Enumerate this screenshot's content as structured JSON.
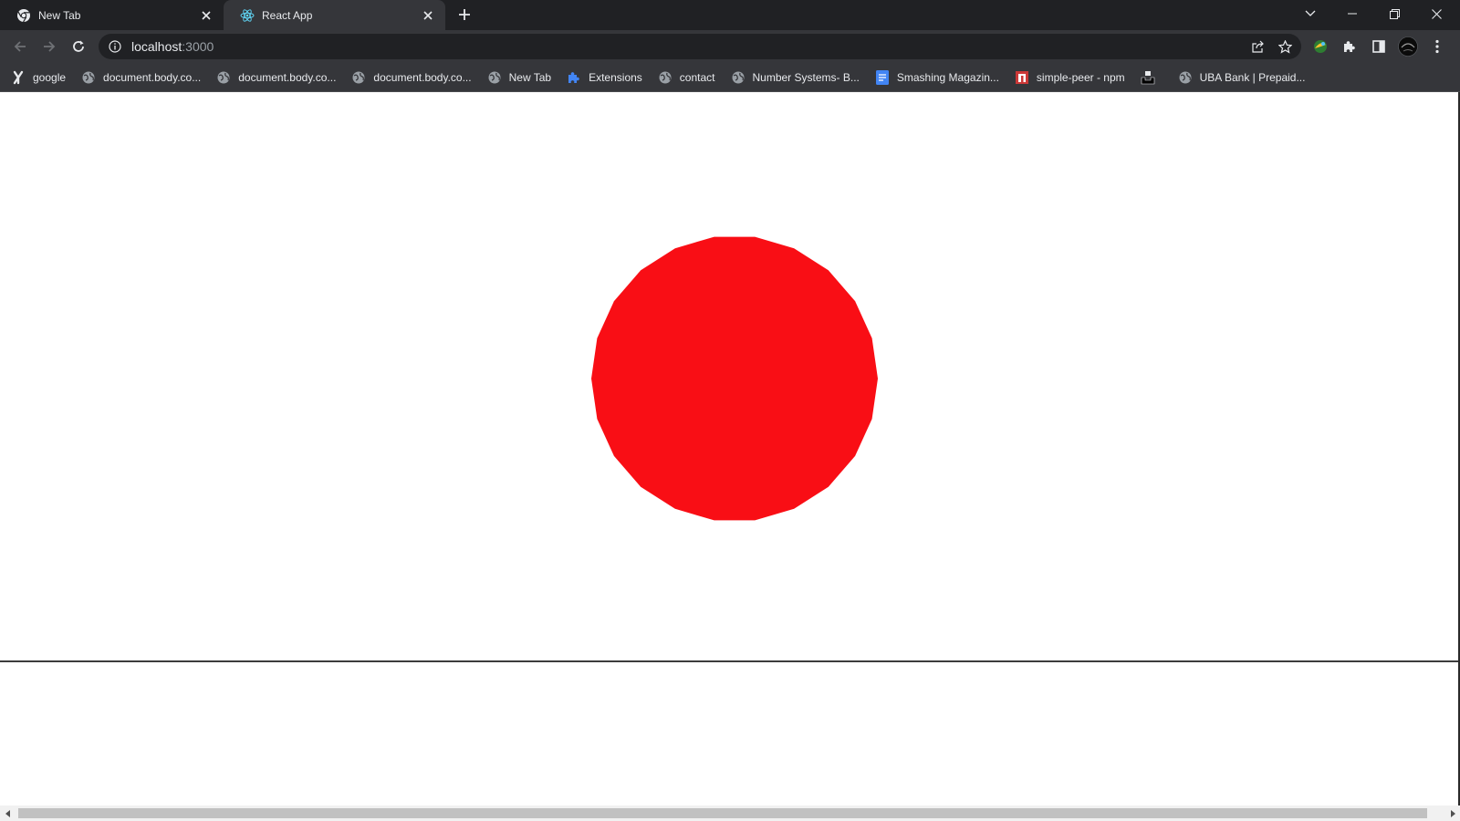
{
  "tabs": [
    {
      "title": "New Tab",
      "favicon": "chrome-icon",
      "active": false
    },
    {
      "title": "React App",
      "favicon": "react-icon",
      "active": true
    }
  ],
  "address_bar": {
    "host": "localhost",
    "port": ":3000"
  },
  "bookmarks": [
    {
      "label": "google",
      "icon": "bookmark-custom-icon"
    },
    {
      "label": "document.body.co...",
      "icon": "globe-icon"
    },
    {
      "label": "document.body.co...",
      "icon": "globe-icon"
    },
    {
      "label": "document.body.co...",
      "icon": "globe-icon"
    },
    {
      "label": "New Tab",
      "icon": "globe-icon"
    },
    {
      "label": "Extensions",
      "icon": "puzzle-icon"
    },
    {
      "label": "contact",
      "icon": "globe-icon"
    },
    {
      "label": "Number Systems- B...",
      "icon": "globe-icon"
    },
    {
      "label": "Smashing Magazin...",
      "icon": "document-icon"
    },
    {
      "label": "simple-peer - npm",
      "icon": "npm-icon"
    },
    {
      "label": "",
      "icon": "unsplash-icon"
    },
    {
      "label": "UBA Bank | Prepaid...",
      "icon": "globe-icon"
    }
  ],
  "page": {
    "circle_color": "#f90e15",
    "background": "#ffffff"
  },
  "colors": {
    "tabstrip": "#202124",
    "toolbar": "#35363a",
    "text": "#e8eaed"
  }
}
